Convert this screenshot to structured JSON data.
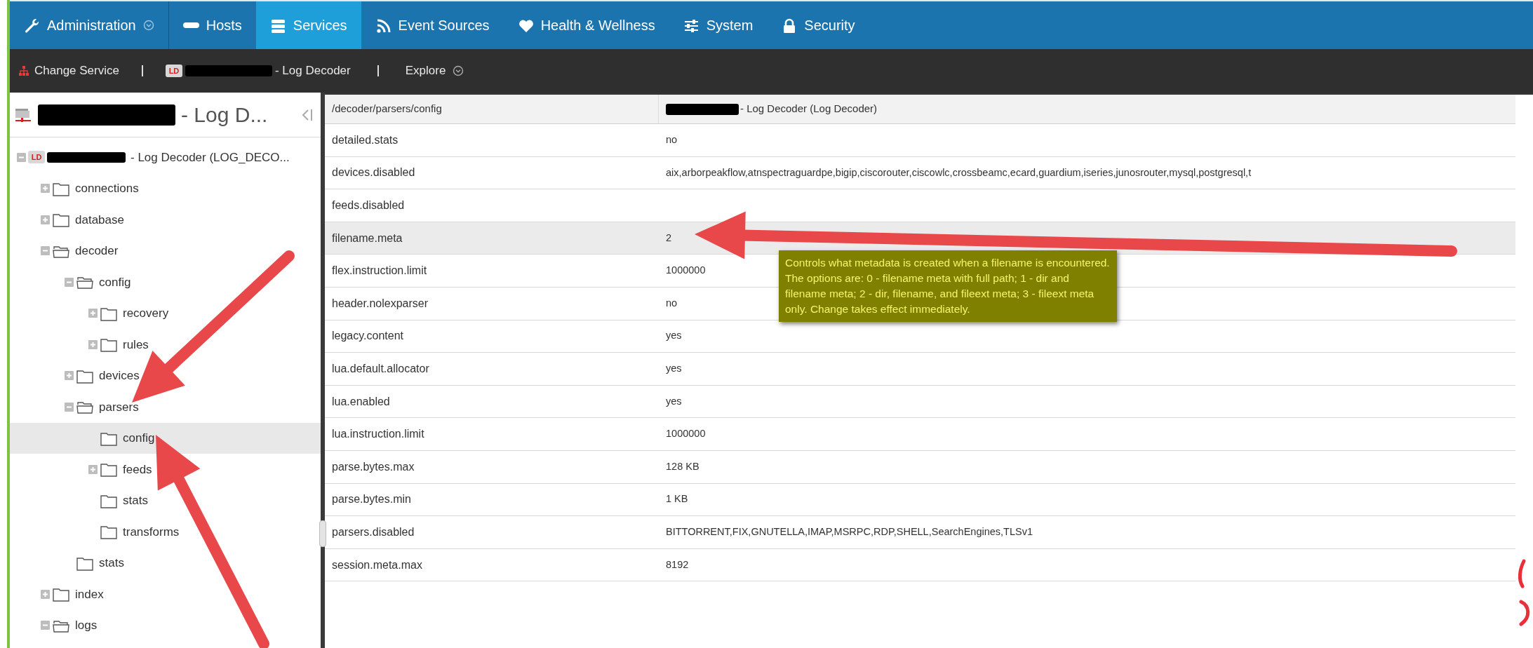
{
  "nav": {
    "tabs": [
      {
        "label": "Administration",
        "selected": false,
        "dropdown": true
      },
      {
        "label": "Hosts",
        "selected": false,
        "dropdown": false
      },
      {
        "label": "Services",
        "selected": true,
        "dropdown": false
      },
      {
        "label": "Event Sources",
        "selected": false,
        "dropdown": false
      },
      {
        "label": "Health & Wellness",
        "selected": false,
        "dropdown": false
      },
      {
        "label": "System",
        "selected": false,
        "dropdown": false
      },
      {
        "label": "Security",
        "selected": false,
        "dropdown": false
      }
    ]
  },
  "toolbar": {
    "change_service": "Change Service",
    "service": {
      "badge": "LD",
      "label": "- Log Decoder"
    },
    "explore": "Explore"
  },
  "sidebar": {
    "title": "- Log D...",
    "tree": [
      {
        "kind": "service",
        "badge": "LD",
        "label": "- Log Decoder (LOG_DECO...",
        "expanded": true,
        "selected": false,
        "children": [
          {
            "kind": "branch",
            "label": "connections",
            "expanded": false,
            "selected": false
          },
          {
            "kind": "branch",
            "label": "database",
            "expanded": false,
            "selected": false
          },
          {
            "kind": "branch",
            "label": "decoder",
            "expanded": true,
            "selected": false,
            "children": [
              {
                "kind": "branch",
                "label": "config",
                "expanded": true,
                "selected": false,
                "children": [
                  {
                    "kind": "branch",
                    "label": "recovery",
                    "expanded": false,
                    "selected": false
                  },
                  {
                    "kind": "branch",
                    "label": "rules",
                    "expanded": false,
                    "selected": false
                  }
                ]
              },
              {
                "kind": "branch",
                "label": "devices",
                "expanded": false,
                "selected": false
              },
              {
                "kind": "branch",
                "label": "parsers",
                "expanded": true,
                "selected": false,
                "children": [
                  {
                    "kind": "leaf",
                    "label": "config",
                    "selected": true
                  },
                  {
                    "kind": "branch",
                    "label": "feeds",
                    "expanded": false,
                    "selected": false
                  },
                  {
                    "kind": "leaf",
                    "label": "stats",
                    "selected": false
                  },
                  {
                    "kind": "leaf",
                    "label": "transforms",
                    "selected": false
                  }
                ]
              },
              {
                "kind": "leaf",
                "label": "stats",
                "selected": false
              }
            ]
          },
          {
            "kind": "branch",
            "label": "index",
            "expanded": false,
            "selected": false
          },
          {
            "kind": "branch",
            "label": "logs",
            "expanded": true,
            "selected": false
          }
        ]
      }
    ]
  },
  "table": {
    "columns": [
      "/decoder/parsers/config",
      "- Log Decoder (Log Decoder)"
    ],
    "rows": [
      {
        "name": "detailed.stats",
        "value": "no",
        "selected": false
      },
      {
        "name": "devices.disabled",
        "value": "aix,arborpeakflow,atnspectraguardpe,bigip,ciscorouter,ciscowlc,crossbeamc,ecard,guardium,iseries,junosrouter,mysql,postgresql,t",
        "selected": false
      },
      {
        "name": "feeds.disabled",
        "selected": false
      },
      {
        "name": "filename.meta",
        "value": "2",
        "selected": true
      },
      {
        "name": "flex.instruction.limit",
        "value": "1000000",
        "selected": false
      },
      {
        "name": "header.nolexparser",
        "value": "no",
        "selected": false
      },
      {
        "name": "legacy.content",
        "value": "yes",
        "selected": false
      },
      {
        "name": "lua.default.allocator",
        "value": "yes",
        "selected": false
      },
      {
        "name": "lua.enabled",
        "value": "yes",
        "selected": false
      },
      {
        "name": "lua.instruction.limit",
        "value": "1000000",
        "selected": false
      },
      {
        "name": "parse.bytes.max",
        "value": "128 KB",
        "selected": false
      },
      {
        "name": "parse.bytes.min",
        "value": "1 KB",
        "selected": false
      },
      {
        "name": "parsers.disabled",
        "value": "BITTORRENT,FIX,GNUTELLA,IMAP,MSRPC,RDP,SHELL,SearchEngines,TLSv1",
        "selected": false
      },
      {
        "name": "session.meta.max",
        "value": "8192",
        "selected": false
      }
    ]
  },
  "tooltip": "Controls what metadata is created when a filename is encountered. The options are: 0 - filename meta with full path; 1 - dir and filename meta; 2 - dir, filename, and fileext meta; 3 - fileext meta only. Change takes effect immediately."
}
